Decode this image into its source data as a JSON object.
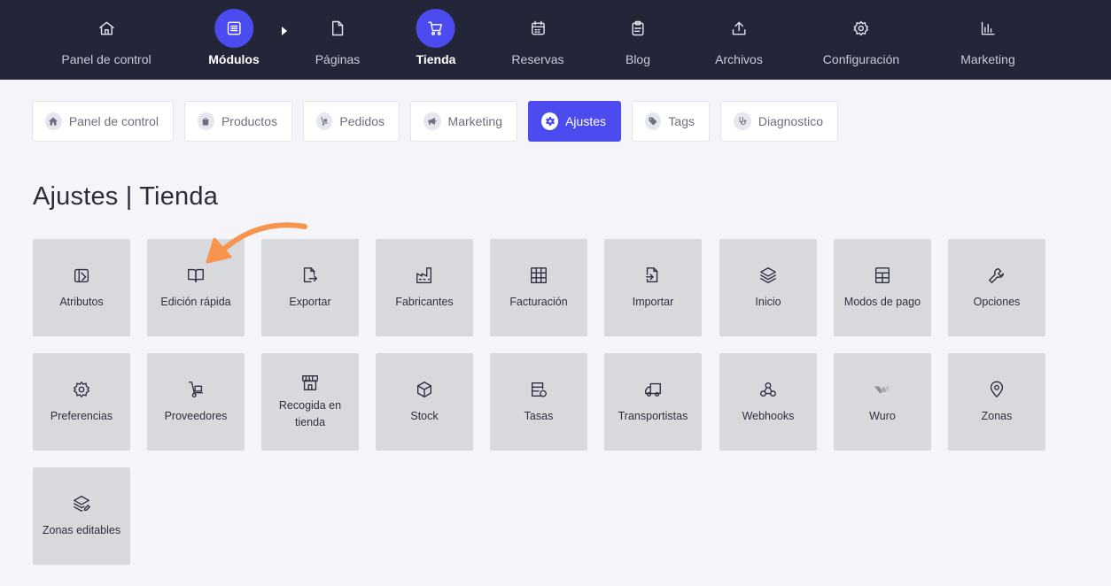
{
  "topnav": [
    {
      "key": "panel",
      "label": "Panel de control",
      "icon": "home-icon"
    },
    {
      "key": "modulos",
      "label": "Módulos",
      "icon": "modules-icon",
      "active": true
    },
    {
      "key": "paginas",
      "label": "Páginas",
      "icon": "page-icon"
    },
    {
      "key": "tienda",
      "label": "Tienda",
      "icon": "cart-icon",
      "active": true
    },
    {
      "key": "reservas",
      "label": "Reservas",
      "icon": "calendar-icon"
    },
    {
      "key": "blog",
      "label": "Blog",
      "icon": "clipboard-icon"
    },
    {
      "key": "archivos",
      "label": "Archivos",
      "icon": "upload-icon"
    },
    {
      "key": "configuracion",
      "label": "Configuración",
      "icon": "gear-icon"
    },
    {
      "key": "marketing",
      "label": "Marketing",
      "icon": "bar-chart-icon"
    }
  ],
  "subnav": [
    {
      "label": "Panel de control",
      "icon": "home-icon"
    },
    {
      "label": "Productos",
      "icon": "bag-icon"
    },
    {
      "label": "Pedidos",
      "icon": "hand-truck-icon"
    },
    {
      "label": "Marketing",
      "icon": "megaphone-icon"
    },
    {
      "label": "Ajustes",
      "icon": "gear-icon",
      "active": true
    },
    {
      "label": "Tags",
      "icon": "tag-icon"
    },
    {
      "label": "Diagnostico",
      "icon": "stethoscope-icon"
    }
  ],
  "page": {
    "title": "Ajustes | Tienda"
  },
  "tiles": [
    {
      "label": "Atributos",
      "icon": "attributes-icon"
    },
    {
      "label": "Edición rápida",
      "icon": "book-icon"
    },
    {
      "label": "Exportar",
      "icon": "export-icon"
    },
    {
      "label": "Fabricantes",
      "icon": "factory-icon"
    },
    {
      "label": "Facturación",
      "icon": "invoice-grid-icon"
    },
    {
      "label": "Importar",
      "icon": "import-icon"
    },
    {
      "label": "Inicio",
      "icon": "layers-icon"
    },
    {
      "label": "Modos de pago",
      "icon": "payment-icon"
    },
    {
      "label": "Opciones",
      "icon": "wrench-icon"
    },
    {
      "label": "Preferencias",
      "icon": "gear-icon"
    },
    {
      "label": "Proveedores",
      "icon": "hand-truck-icon"
    },
    {
      "label": "Recogida en tienda",
      "icon": "store-icon"
    },
    {
      "label": "Stock",
      "icon": "box-icon"
    },
    {
      "label": "Tasas",
      "icon": "tax-icon"
    },
    {
      "label": "Transportistas",
      "icon": "truck-icon"
    },
    {
      "label": "Webhooks",
      "icon": "webhook-icon"
    },
    {
      "label": "Wuro",
      "icon": "wuro-logo-icon"
    },
    {
      "label": "Zonas",
      "icon": "location-pin-icon"
    },
    {
      "label": "Zonas editables",
      "icon": "layers-edit-icon"
    }
  ],
  "colors": {
    "topbar": "#232639",
    "accent": "#4b4bf0",
    "tile": "#d7d9dd",
    "arrow": "#f7954f",
    "background": "#f5f5f9"
  }
}
